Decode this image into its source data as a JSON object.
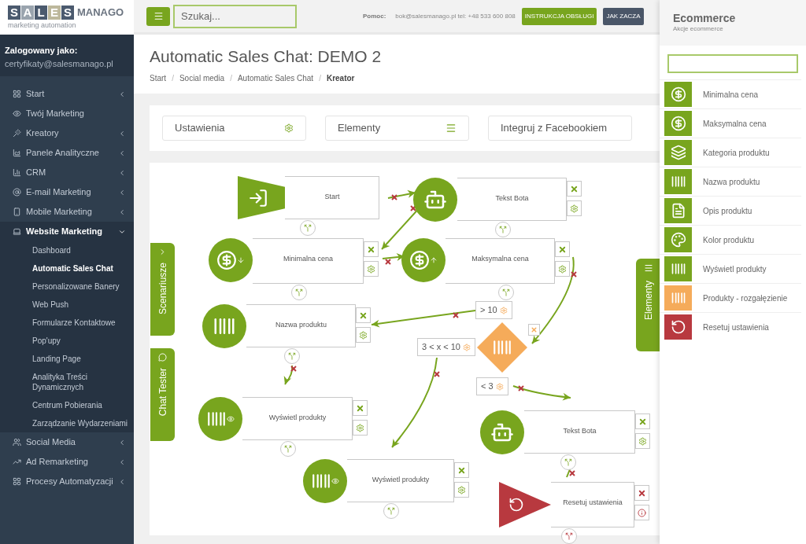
{
  "logo": {
    "letters": [
      "S",
      "A",
      "L",
      "E",
      "S"
    ],
    "word": "MANAGO",
    "tagline": "marketing automation"
  },
  "topbar": {
    "search_placeholder": "Szukaj...",
    "help_label": "Pomoc:",
    "contact": "bok@salesmanago.pl tel: +48 533 600 808",
    "buttons": [
      {
        "label": "INSTRUKCJA OBSŁUGI",
        "kind": "primary"
      },
      {
        "label": "JAK ZACZA",
        "kind": "secondary"
      }
    ]
  },
  "user": {
    "label": "Zalogowany jako:",
    "email": "certyfikaty@salesmanago.pl"
  },
  "sidebar": {
    "items": [
      {
        "label": "Start",
        "kind": "group",
        "expanded": false
      },
      {
        "label": "Twój Marketing",
        "kind": "link",
        "expanded": false
      },
      {
        "label": "Kreatory",
        "kind": "group",
        "expanded": false
      },
      {
        "label": "Panele Analityczne",
        "kind": "group",
        "expanded": false
      },
      {
        "label": "CRM",
        "kind": "group",
        "expanded": false
      },
      {
        "label": "E-mail Marketing",
        "kind": "group",
        "expanded": false
      },
      {
        "label": "Mobile Marketing",
        "kind": "group",
        "expanded": false
      },
      {
        "label": "Website Marketing",
        "kind": "group",
        "expanded": true,
        "children": [
          {
            "label": "Dashboard",
            "selected": false
          },
          {
            "label": "Automatic Sales Chat",
            "selected": true
          },
          {
            "label": "Personalizowane Banery",
            "selected": false
          },
          {
            "label": "Web Push",
            "selected": false
          },
          {
            "label": "Formularze Kontaktowe",
            "selected": false
          },
          {
            "label": "Pop'upy",
            "selected": false
          },
          {
            "label": "Landing Page",
            "selected": false
          },
          {
            "label": "Analityka Treści Dynamicznych",
            "selected": false
          },
          {
            "label": "Centrum Pobierania",
            "selected": false
          },
          {
            "label": "Zarządzanie Wydarzeniami",
            "selected": false
          }
        ]
      },
      {
        "label": "Social Media",
        "kind": "group",
        "expanded": false
      },
      {
        "label": "Ad Remarketing",
        "kind": "group",
        "expanded": false
      },
      {
        "label": "Procesy Automatyzacji",
        "kind": "group",
        "expanded": false
      }
    ]
  },
  "page": {
    "title": "Automatic Sales Chat: DEMO 2",
    "breadcrumbs": [
      {
        "label": "Start",
        "current": false
      },
      {
        "separator": "/",
        "label": "Social media",
        "current": false
      },
      {
        "separator": "/",
        "label": "Automatic Sales Chat",
        "current": false
      },
      {
        "separator": "/",
        "label": "Kreator",
        "current": true
      }
    ]
  },
  "toolbar": [
    "Ustawienia",
    "Elementy",
    "Integruj z Facebookiem"
  ],
  "canvas": {
    "side_tabs": [
      "Scenariusze",
      "Chat Tester"
    ],
    "elements_tab": "Elementy",
    "nodes": [
      {
        "label": "Start",
        "kind": "start"
      },
      {
        "label": "Tekst Bota",
        "kind": "bot"
      },
      {
        "label": "Minimalna cena",
        "kind": "min_price"
      },
      {
        "label": "Maksymalna cena",
        "kind": "max_price"
      },
      {
        "label": "Nazwa produktu",
        "kind": "barcode"
      },
      {
        "label": "Wyświetl produkty",
        "kind": "display"
      },
      {
        "label": "Tekst Bota",
        "kind": "bot"
      },
      {
        "label": "Wyświetl produkty",
        "kind": "display"
      },
      {
        "label": "Resetuj ustawienia",
        "kind": "reset"
      }
    ],
    "conditions": [
      "> 10",
      "3 < x < 10",
      "< 3"
    ]
  },
  "panel": {
    "title": "Ecommerce",
    "subtitle": "Akcje ecommerce",
    "items": [
      {
        "label": "Minimalna cena",
        "kind": "min_price"
      },
      {
        "label": "Maksymalna cena",
        "kind": "max_price"
      },
      {
        "label": "Kategoria produktu",
        "kind": "category"
      },
      {
        "label": "Nazwa produktu",
        "kind": "barcode"
      },
      {
        "label": "Opis produktu",
        "kind": "description"
      },
      {
        "label": "Kolor produktu",
        "kind": "color"
      },
      {
        "label": "Wyświetl produkty",
        "kind": "display"
      },
      {
        "label": "Produkty - rozgałęzienie",
        "kind": "branch"
      },
      {
        "label": "Resetuj ustawienia",
        "kind": "reset"
      }
    ]
  }
}
